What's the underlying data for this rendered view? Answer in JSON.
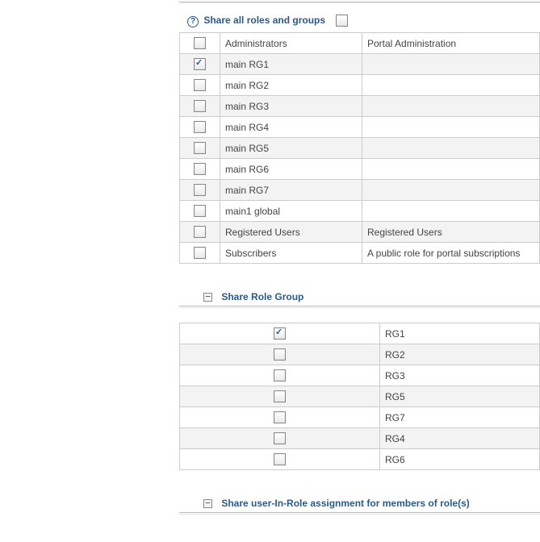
{
  "top": {
    "share_all_label": "Share all roles and groups",
    "share_all_checked": false
  },
  "roles_table": [
    {
      "checked": false,
      "name": "Administrators",
      "desc": "Portal Administration"
    },
    {
      "checked": true,
      "name": "main RG1",
      "desc": ""
    },
    {
      "checked": false,
      "name": "main RG2",
      "desc": ""
    },
    {
      "checked": false,
      "name": "main RG3",
      "desc": ""
    },
    {
      "checked": false,
      "name": "main RG4",
      "desc": ""
    },
    {
      "checked": false,
      "name": "main RG5",
      "desc": ""
    },
    {
      "checked": false,
      "name": "main RG6",
      "desc": ""
    },
    {
      "checked": false,
      "name": "main RG7",
      "desc": ""
    },
    {
      "checked": false,
      "name": "main1 global",
      "desc": ""
    },
    {
      "checked": false,
      "name": "Registered Users",
      "desc": "Registered Users"
    },
    {
      "checked": false,
      "name": "Subscribers",
      "desc": "A public role for portal subscriptions"
    }
  ],
  "role_group_section": {
    "title": "Share Role Group"
  },
  "role_group_table": [
    {
      "checked": true,
      "name": "RG1"
    },
    {
      "checked": false,
      "name": "RG2"
    },
    {
      "checked": false,
      "name": "RG3"
    },
    {
      "checked": false,
      "name": "RG5"
    },
    {
      "checked": false,
      "name": "RG7"
    },
    {
      "checked": false,
      "name": "RG4"
    },
    {
      "checked": false,
      "name": "RG6"
    }
  ],
  "user_in_role_section": {
    "title": "Share user-In-Role assignment for members of role(s)"
  }
}
